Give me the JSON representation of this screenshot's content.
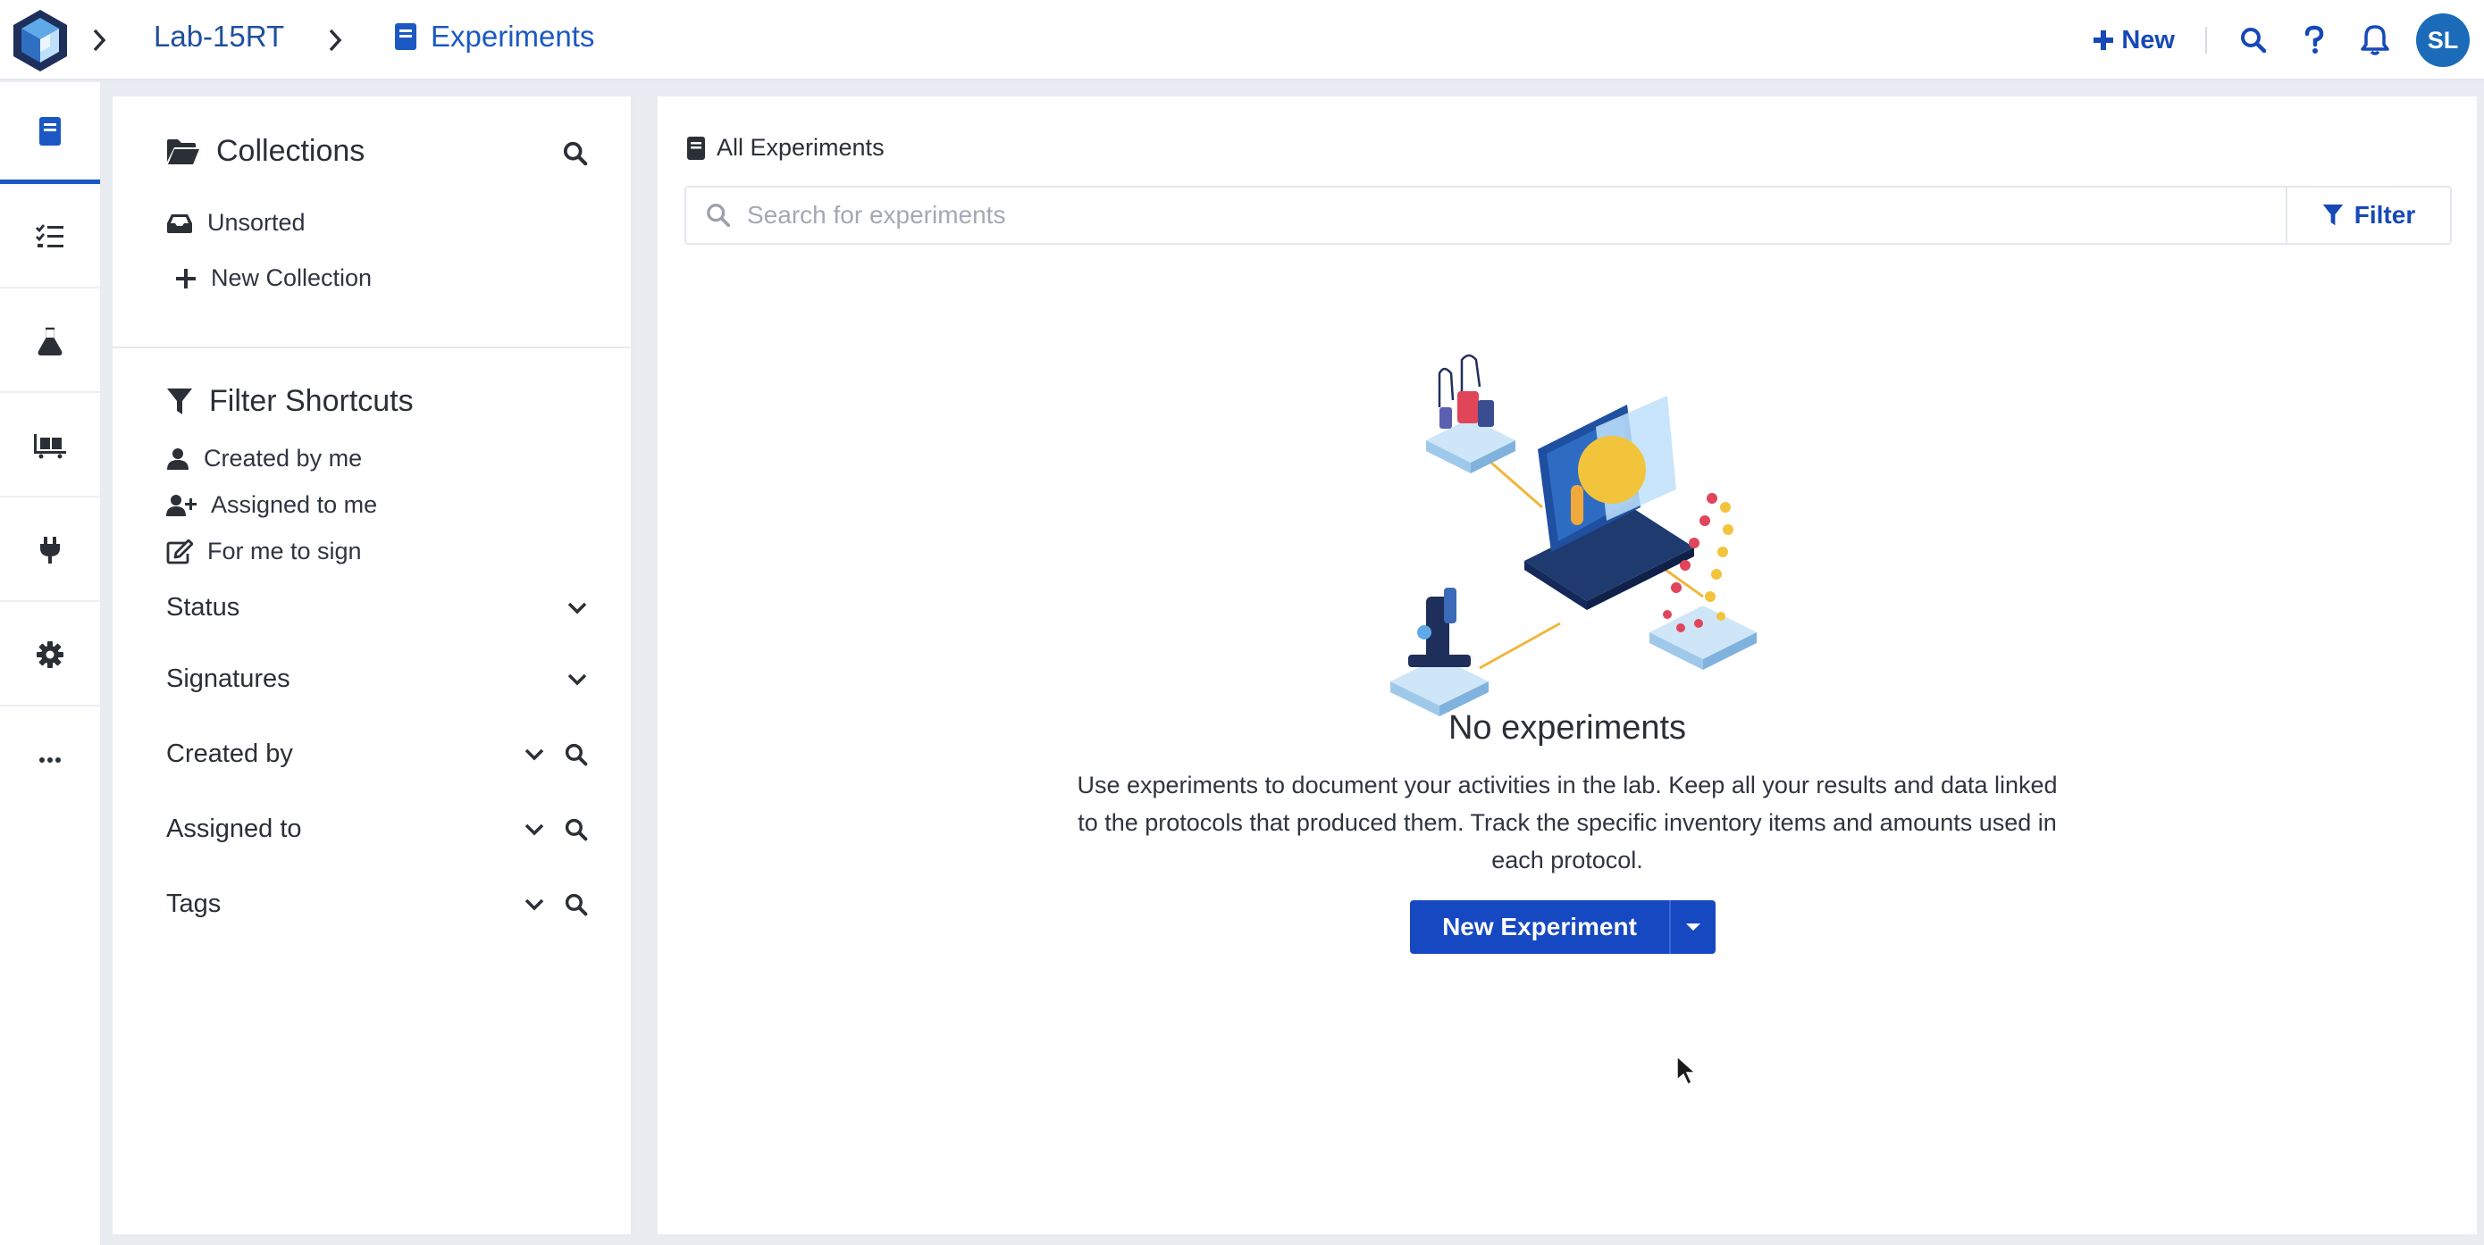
{
  "header": {
    "breadcrumb": [
      {
        "label": "Lab-15RT"
      },
      {
        "label": "Experiments"
      }
    ],
    "new_label": "New",
    "avatar_initials": "SL",
    "accent_color": "#1b58c4"
  },
  "rail": {
    "items": [
      {
        "icon": "notebook-icon",
        "active": true
      },
      {
        "icon": "checklist-icon",
        "active": false
      },
      {
        "icon": "flask-icon",
        "active": false
      },
      {
        "icon": "inventory-cart-icon",
        "active": false
      },
      {
        "icon": "plug-icon",
        "active": false
      },
      {
        "icon": "gear-icon",
        "active": false
      },
      {
        "icon": "more-icon",
        "active": false
      }
    ]
  },
  "collections": {
    "title": "Collections",
    "unsorted_label": "Unsorted",
    "new_collection_label": "New Collection"
  },
  "filters": {
    "title": "Filter Shortcuts",
    "shortcuts": [
      {
        "label": "Created by me",
        "icon": "user-icon"
      },
      {
        "label": "Assigned to me",
        "icon": "user-plus-icon"
      },
      {
        "label": "For me to sign",
        "icon": "edit-icon"
      }
    ],
    "groups": [
      {
        "label": "Status",
        "searchable": false
      },
      {
        "label": "Signatures",
        "searchable": false
      },
      {
        "label": "Created by",
        "searchable": true
      },
      {
        "label": "Assigned to",
        "searchable": true
      },
      {
        "label": "Tags",
        "searchable": true
      }
    ]
  },
  "main": {
    "title": "All Experiments",
    "search_placeholder": "Search for experiments",
    "filter_label": "Filter",
    "empty_title": "No experiments",
    "empty_description": "Use experiments to document your activities in the lab. Keep all your results and data linked to the protocols that produced them. Track the specific inventory items and amounts used in each protocol.",
    "cta_label": "New Experiment"
  }
}
